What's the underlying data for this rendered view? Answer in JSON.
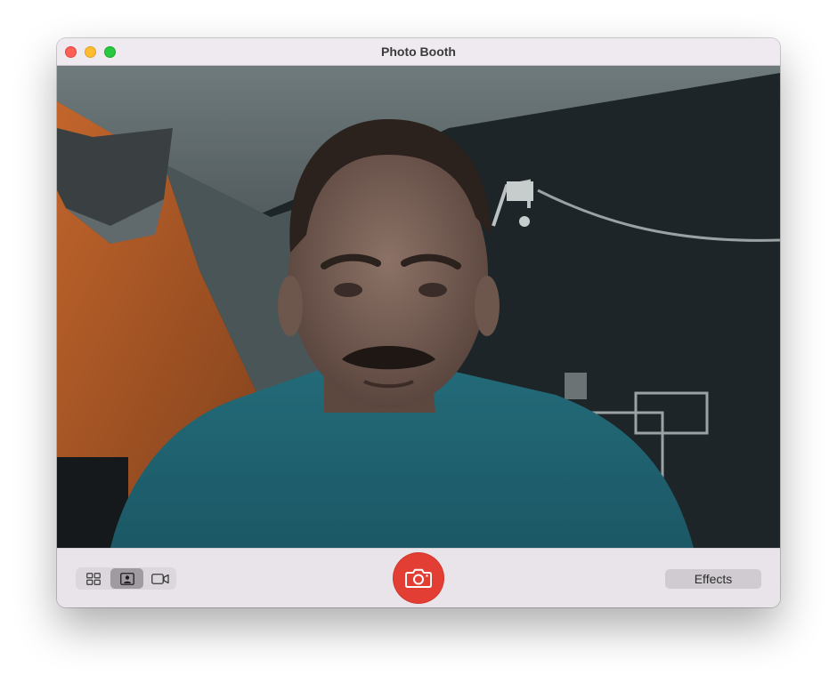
{
  "window": {
    "title": "Photo Booth"
  },
  "viewport": {
    "content": "live-camera-preview"
  },
  "toolbar": {
    "mode_buttons": [
      {
        "name": "four-photo-mode",
        "icon": "grid-four-icon",
        "selected": false
      },
      {
        "name": "single-photo-mode",
        "icon": "portrait-photo-icon",
        "selected": true
      },
      {
        "name": "video-mode",
        "icon": "video-camera-icon",
        "selected": false
      }
    ],
    "shutter_icon": "camera-icon",
    "effects_label": "Effects"
  },
  "colors": {
    "close": "#fe5f57",
    "minimize": "#febc2e",
    "maximize": "#28c840",
    "shutter": "#e23e33",
    "window_background": "#ece9ed"
  }
}
